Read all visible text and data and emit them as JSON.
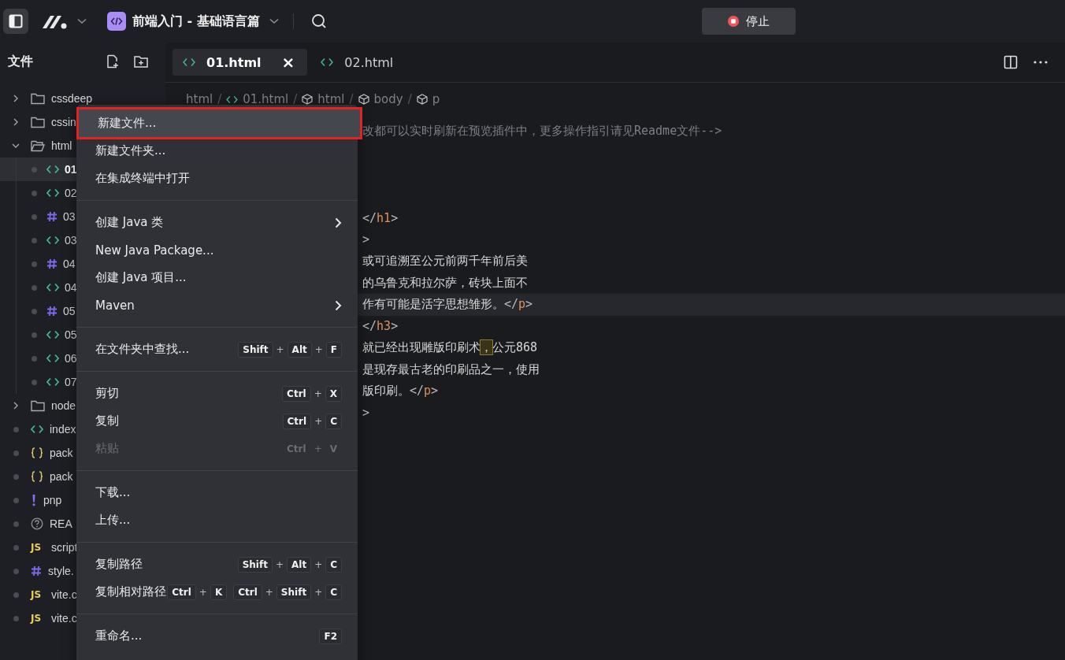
{
  "topbar": {
    "project_title": "前端入门 - 基础语言篇",
    "stop_button": "停止"
  },
  "sidebar": {
    "title": "文件",
    "tree": [
      {
        "label": "cssdeep",
        "kind": "folder",
        "expanded": false,
        "selected": false
      },
      {
        "label": "cssin",
        "kind": "folder",
        "expanded": false,
        "selected": false
      },
      {
        "label": "html",
        "kind": "folder",
        "expanded": true,
        "selected": false,
        "children": [
          {
            "label": "01",
            "kind": "html",
            "selected": true
          },
          {
            "label": "02",
            "kind": "html",
            "selected": false
          },
          {
            "label": "03",
            "kind": "css",
            "selected": false
          },
          {
            "label": "03",
            "kind": "html",
            "selected": false
          },
          {
            "label": "04",
            "kind": "css",
            "selected": false
          },
          {
            "label": "04",
            "kind": "html",
            "selected": false
          },
          {
            "label": "05",
            "kind": "css",
            "selected": false
          },
          {
            "label": "05",
            "kind": "html",
            "selected": false
          },
          {
            "label": "06",
            "kind": "html",
            "selected": false
          },
          {
            "label": "07",
            "kind": "html",
            "selected": false
          }
        ]
      },
      {
        "label": "node",
        "kind": "folder",
        "expanded": false,
        "selected": false
      },
      {
        "label": "index",
        "kind": "html",
        "selected": false
      },
      {
        "label": "pack",
        "kind": "json",
        "selected": false
      },
      {
        "label": "pack",
        "kind": "json",
        "selected": false
      },
      {
        "label": "pnp",
        "kind": "yaml",
        "selected": false
      },
      {
        "label": "REA",
        "kind": "readme",
        "selected": false
      },
      {
        "label": "script",
        "kind": "js",
        "badge": "JS",
        "selected": false
      },
      {
        "label": "style.",
        "kind": "css",
        "selected": false
      },
      {
        "label": "vite.c",
        "kind": "js",
        "badge": "JS",
        "selected": false
      },
      {
        "label": "vite.c",
        "kind": "js",
        "badge": "JS",
        "selected": false
      }
    ]
  },
  "editor": {
    "tabs": [
      {
        "label": "01.html",
        "selected": true,
        "close": "×"
      },
      {
        "label": "02.html",
        "selected": false
      }
    ],
    "breadcrumb": [
      {
        "label": "html",
        "kind": "text"
      },
      {
        "label": "01.html",
        "kind": "file"
      },
      {
        "label": "html",
        "kind": "element"
      },
      {
        "label": "body",
        "kind": "element"
      },
      {
        "label": "p",
        "kind": "element"
      }
    ],
    "breadcrumb_separator": [
      "/",
      "/",
      "/",
      "/"
    ],
    "lines": [
      {
        "kind": "code",
        "current": false,
        "segments": [
          {
            "text": "改都可以实时刷新在预览插件中，更多操作指引请见Readme文件-->",
            "kind": "comment"
          }
        ]
      },
      {
        "kind": "blank"
      },
      {
        "kind": "blank"
      },
      {
        "kind": "blank"
      },
      {
        "kind": "code",
        "current": false,
        "segments": [
          {
            "text": "</",
            "kind": "punct"
          },
          {
            "text": "h1",
            "kind": "tag"
          },
          {
            "text": ">",
            "kind": "punct"
          }
        ]
      },
      {
        "kind": "code",
        "current": false,
        "segments": [
          {
            "text": ">",
            "kind": "punct"
          }
        ]
      },
      {
        "kind": "code",
        "current": false,
        "segments": [
          {
            "text": "或可追溯至公元前两千年前后美",
            "kind": "plain"
          }
        ]
      },
      {
        "kind": "code",
        "current": false,
        "segments": [
          {
            "text": "的乌鲁克和拉尔萨，砖块上面不",
            "kind": "plain"
          }
        ]
      },
      {
        "kind": "code",
        "current": true,
        "segments": [
          {
            "text": "作有可能是活字思想雏形。",
            "kind": "plain"
          },
          {
            "text": "</",
            "kind": "punct"
          },
          {
            "text": "p",
            "kind": "tag"
          },
          {
            "text": ">",
            "kind": "punct"
          }
        ]
      },
      {
        "kind": "code",
        "current": false,
        "segments": [
          {
            "text": "</",
            "kind": "punct"
          },
          {
            "text": "h3",
            "kind": "tag"
          },
          {
            "text": ">",
            "kind": "punct"
          }
        ]
      },
      {
        "kind": "code",
        "current": false,
        "segments": [
          {
            "text": "就已经出现雕版印刷术",
            "kind": "plain"
          },
          {
            "text": "，",
            "kind": "match"
          },
          {
            "text": "公元868",
            "kind": "plain"
          }
        ]
      },
      {
        "kind": "code",
        "current": false,
        "segments": [
          {
            "text": "是现存最古老的印刷品之一，使用",
            "kind": "plain"
          }
        ]
      },
      {
        "kind": "code",
        "current": false,
        "segments": [
          {
            "text": "版印刷。",
            "kind": "plain"
          },
          {
            "text": "</",
            "kind": "punct"
          },
          {
            "text": "p",
            "kind": "tag"
          },
          {
            "text": ">",
            "kind": "punct"
          }
        ]
      },
      {
        "kind": "code",
        "current": false,
        "segments": [
          {
            "text": ">",
            "kind": "punct"
          }
        ]
      }
    ]
  },
  "context_menu": {
    "groups": [
      [
        {
          "label": "新建文件...",
          "selected": true,
          "disabled": false,
          "submenu": false
        },
        {
          "label": "新建文件夹...",
          "selected": false,
          "disabled": false,
          "submenu": false
        },
        {
          "label": "在集成终端中打开",
          "selected": false,
          "disabled": false,
          "submenu": false
        }
      ],
      [
        {
          "label": "创建 Java 类",
          "selected": false,
          "disabled": false,
          "submenu": true
        },
        {
          "label": "New Java Package...",
          "selected": false,
          "disabled": false,
          "submenu": false
        },
        {
          "label": "创建 Java 项目...",
          "selected": false,
          "disabled": false,
          "submenu": false
        },
        {
          "label": "Maven",
          "selected": false,
          "disabled": false,
          "submenu": true
        }
      ],
      [
        {
          "label": "在文件夹中查找...",
          "selected": false,
          "disabled": false,
          "submenu": false,
          "shortcut": [
            [
              "Shift",
              "+",
              "Alt",
              "+",
              "F"
            ]
          ]
        }
      ],
      [
        {
          "label": "剪切",
          "selected": false,
          "disabled": false,
          "submenu": false,
          "shortcut": [
            [
              "Ctrl",
              "+",
              "X"
            ]
          ]
        },
        {
          "label": "复制",
          "selected": false,
          "disabled": false,
          "submenu": false,
          "shortcut": [
            [
              "Ctrl",
              "+",
              "C"
            ]
          ]
        },
        {
          "label": "粘贴",
          "selected": false,
          "disabled": true,
          "submenu": false,
          "shortcut": [
            [
              "Ctrl",
              "+",
              "V"
            ]
          ]
        }
      ],
      [
        {
          "label": "下载...",
          "selected": false,
          "disabled": false,
          "submenu": false
        },
        {
          "label": "上传...",
          "selected": false,
          "disabled": false,
          "submenu": false
        }
      ],
      [
        {
          "label": "复制路径",
          "selected": false,
          "disabled": false,
          "submenu": false,
          "shortcut": [
            [
              "Shift",
              "+",
              "Alt",
              "+",
              "C"
            ]
          ]
        },
        {
          "label": "复制相对路径",
          "selected": false,
          "disabled": false,
          "submenu": false,
          "shortcut": [
            [
              "Ctrl",
              "+",
              "K"
            ],
            [
              "Ctrl",
              "+",
              "Shift",
              "+",
              "C"
            ]
          ]
        }
      ],
      [
        {
          "label": "重命名...",
          "selected": false,
          "disabled": false,
          "submenu": false,
          "shortcut": [
            [
              "F2"
            ]
          ]
        }
      ]
    ]
  }
}
